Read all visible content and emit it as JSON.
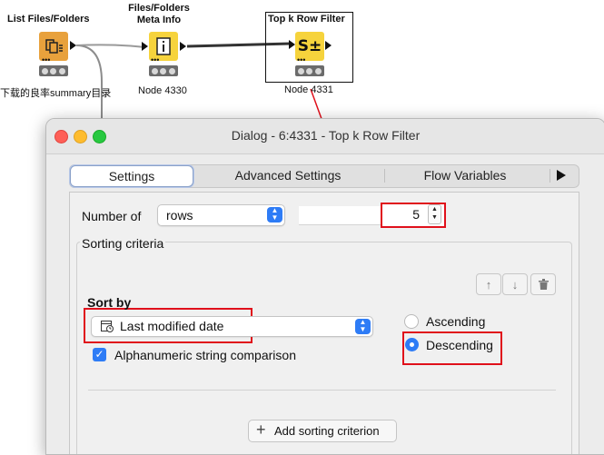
{
  "workflow": {
    "nodes": [
      {
        "title": "List Files/Folders",
        "subtitle": "下载的良率summary目录"
      },
      {
        "title": "Files/Folders\nMeta Info",
        "subtitle": "Node 4330"
      },
      {
        "title": "Top k Row Filter",
        "subtitle": "Node 4331"
      }
    ]
  },
  "dialog": {
    "title": "Dialog - 6:4331 - Top k Row Filter",
    "tabs": [
      "Settings",
      "Advanced Settings",
      "Flow Variables"
    ],
    "active_tab": "Settings",
    "number_of_label": "Number of",
    "number_of_mode": "rows",
    "number_value": "5",
    "sorting_criteria_label": "Sorting criteria",
    "sort_by_label": "Sort by",
    "sort_by_value": "Last modified date",
    "alphanumeric_label": "Alphanumeric string comparison",
    "alphanumeric_checked": true,
    "order_options": [
      "Ascending",
      "Descending"
    ],
    "order_selected": "Descending",
    "add_sorting_label": "Add sorting criterion"
  },
  "colors": {
    "highlight": "#e0101b",
    "accent": "#2e7cf6",
    "node_orange": "#e8a13c",
    "node_yellow": "#f6d33c"
  }
}
